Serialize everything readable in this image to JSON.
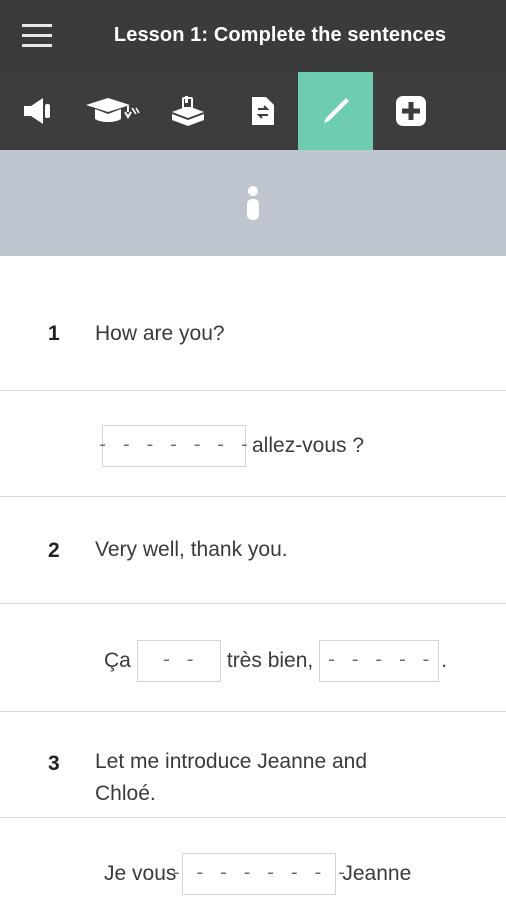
{
  "header": {
    "title": "Lesson 1: Complete the sentences"
  },
  "toolbar": {
    "tools": [
      {
        "icon": "speaker-icon"
      },
      {
        "icon": "graduation-cap-icon"
      },
      {
        "icon": "hand-tray-icon"
      },
      {
        "icon": "document-swap-icon"
      },
      {
        "icon": "pencil-icon",
        "active": true
      },
      {
        "icon": "plus-icon"
      }
    ],
    "active_color": "#6ecdb0"
  },
  "info": {
    "icon": "info-icon"
  },
  "exercises": [
    {
      "number": "1",
      "prompt": "How are you?",
      "answer": {
        "blank1": "- - - - - - -",
        "after1": "allez-vous ?"
      }
    },
    {
      "number": "2",
      "prompt": "Very well, thank you.",
      "answer": {
        "before": "Ça",
        "blank1": "- -",
        "middle": "très bien,",
        "blank2": "- - - - -",
        "after": "."
      }
    },
    {
      "number": "3",
      "prompt": "Let me introduce Jeanne and Chloé.",
      "answer": {
        "before": "Je vous",
        "blank1": "- - - - - - - -",
        "after": "Jeanne"
      }
    }
  ]
}
